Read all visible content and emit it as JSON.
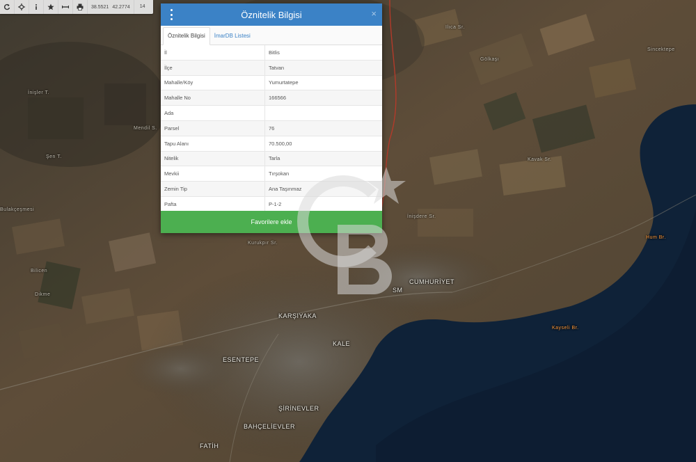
{
  "toolbar": {
    "tools": [
      {
        "name": "refresh-icon"
      },
      {
        "name": "locate-icon"
      },
      {
        "name": "info-icon"
      },
      {
        "name": "star-icon"
      },
      {
        "name": "measure-icon"
      },
      {
        "name": "print-icon"
      }
    ],
    "lat": "38.5521",
    "lon": "42.2774",
    "zoom": "14"
  },
  "map": {
    "places": [
      {
        "label": "İnişler T.",
        "small": true
      },
      {
        "label": "Mendil S."
      },
      {
        "label": "Şen T.",
        "small": true
      },
      {
        "label": "Bulakçeşmesi",
        "small": true
      },
      {
        "label": "Bilicen",
        "small": true
      },
      {
        "label": "Dikme",
        "small": true
      },
      {
        "label": "Kurukpır Sr.",
        "small": true
      },
      {
        "label": "İnişdere Sr.",
        "small": true
      },
      {
        "label": "Gölkaşı",
        "small": true
      },
      {
        "label": "Sincektepe",
        "small": true
      },
      {
        "label": "Hum Br.",
        "orange": true
      },
      {
        "label": "Kayseli Br.",
        "orange": true
      },
      {
        "label": "CUMHURİYET"
      },
      {
        "label": "SM"
      },
      {
        "label": "KARŞIYAKA"
      },
      {
        "label": "KALE"
      },
      {
        "label": "ESENTEPE"
      },
      {
        "label": "ŞİRİNEVLER"
      },
      {
        "label": "BAHÇELİEVLER"
      },
      {
        "label": "FATİH"
      },
      {
        "label": "Ilıca Sr.",
        "small": true
      },
      {
        "label": "Kavak Sr.",
        "small": true
      }
    ]
  },
  "dialog": {
    "title": "Öznitelik Bilgisi",
    "close_label": "×",
    "tabs": [
      "Öznitelik Bilgisi",
      "İmarDB Listesi"
    ],
    "rows": [
      {
        "label": "İl",
        "value": "Bitlis"
      },
      {
        "label": "İlçe",
        "value": "Tatvan"
      },
      {
        "label": "Mahalle/Köy",
        "value": "Yumurtatepe"
      },
      {
        "label": "Mahalle No",
        "value": "166566"
      },
      {
        "label": "Ada",
        "value": ""
      },
      {
        "label": "Parsel",
        "value": "76"
      },
      {
        "label": "Tapu Alanı",
        "value": "70.500,00"
      },
      {
        "label": "Nitelik",
        "value": "Tarla"
      },
      {
        "label": "Mevkii",
        "value": "Tırşokan"
      },
      {
        "label": "Zemin Tip",
        "value": "Ana Taşınmaz"
      },
      {
        "label": "Pafta",
        "value": "P-1-2"
      }
    ],
    "fav_button": "Favorilere ekle"
  },
  "colors": {
    "header": "#3b82c6",
    "fav_button": "#4caf50",
    "lake": "#0f2238",
    "land": "#5a4c3a"
  }
}
